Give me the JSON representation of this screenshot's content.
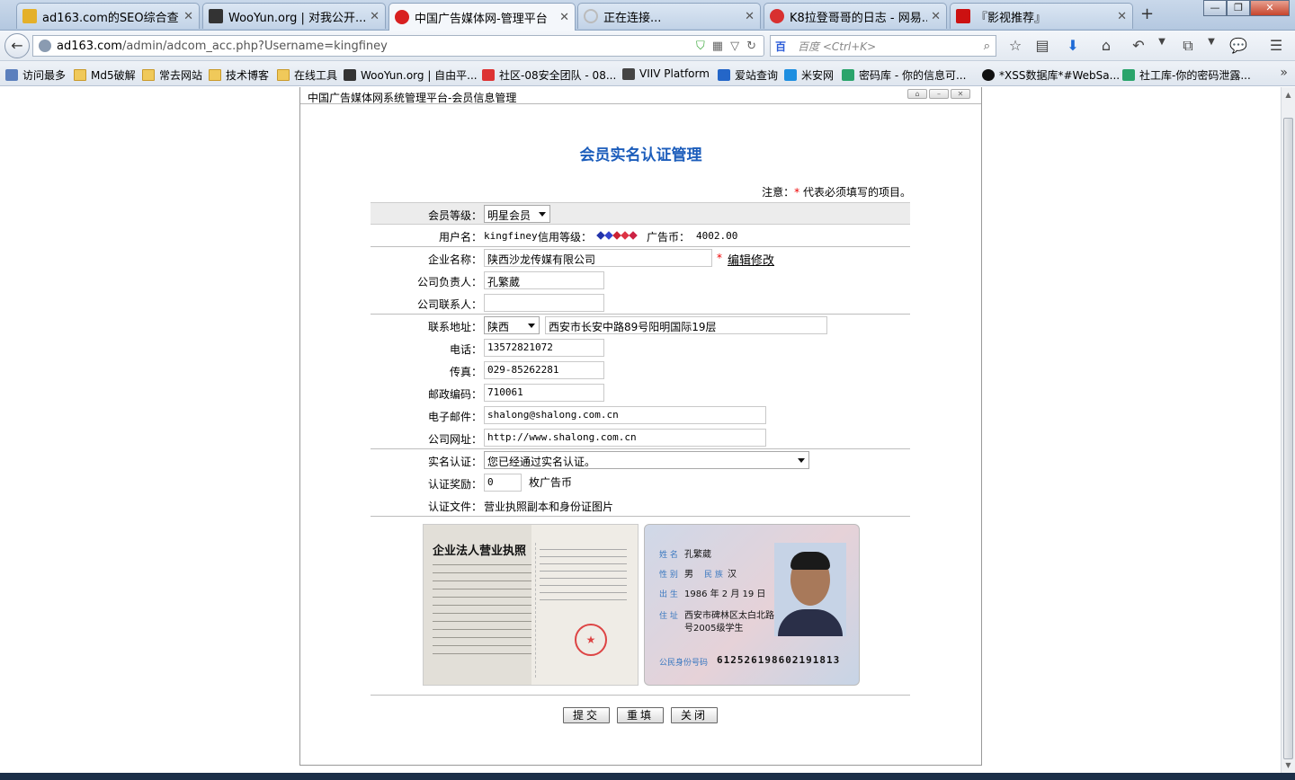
{
  "tabs": [
    {
      "title": "ad163.com的SEO综合查...",
      "fav": "#e4b02a"
    },
    {
      "title": "WooYun.org | 对我公开...",
      "fav": "#333333"
    },
    {
      "title": "中国广告媒体网-管理平台",
      "fav": "#d82020",
      "active": true
    },
    {
      "title": "正在连接...",
      "fav": "#bbbbbb"
    },
    {
      "title": "K8拉登哥哥的日志 - 网易...",
      "fav": "#d83030"
    },
    {
      "title": "『影视推荐』",
      "fav": "#cc1111"
    }
  ],
  "address": {
    "host": "ad163.com",
    "path": "/admin/adcom_acc.php?Username=kingfiney"
  },
  "search": {
    "engine": "百",
    "placeholder": "百度 <Ctrl+K>"
  },
  "bookmarks": [
    {
      "label": "访问最多",
      "icon": "site"
    },
    {
      "label": "Md5破解",
      "icon": "folder"
    },
    {
      "label": "常去网站",
      "icon": "folder"
    },
    {
      "label": "技术博客",
      "icon": "folder"
    },
    {
      "label": "在线工具",
      "icon": "folder"
    },
    {
      "label": "WooYun.org | 自由平...",
      "icon": "site"
    },
    {
      "label": "社区-08安全团队 - 08...",
      "icon": "red"
    },
    {
      "label": "VIIV Platform",
      "icon": "site"
    },
    {
      "label": "爱站查询",
      "icon": "site"
    },
    {
      "label": "米安网",
      "icon": "site"
    },
    {
      "label": "密码库 - 你的信息可...",
      "icon": "green"
    },
    {
      "label": "*XSS数据库*#WebSa...",
      "icon": "site"
    },
    {
      "label": "社工库-你的密码泄露...",
      "icon": "green"
    }
  ],
  "panel": {
    "title": "中国广告媒体网系统管理平台-会员信息管理",
    "heading": "会员实名认证管理",
    "note_prefix": "注意：",
    "note_star": "*",
    "note_suffix": " 代表必须填写的项目。"
  },
  "form": {
    "level_label": "会员等级：",
    "level_value": "明星会员",
    "username_label": "用户名：",
    "username_value": "kingfiney",
    "credit_label": "信用等级：",
    "gem_colors": [
      "#2233aa",
      "#3344cc",
      "#cc2233",
      "#dd3344",
      "#cc2244"
    ],
    "coins_label": "广告币：",
    "coins_value": "4002.00",
    "company_label": "企业名称：",
    "company_value": "陕西沙龙传媒有限公司",
    "required_star": "*",
    "edit_link": "编辑修改",
    "manager_label": "公司负责人：",
    "manager_value": "孔繁葳",
    "contact_label": "公司联系人：",
    "contact_value": "",
    "address_label": "联系地址：",
    "province_value": "陕西",
    "address_value": "西安市长安中路89号阳明国际19层",
    "phone_label": "电话：",
    "phone_value": "13572821072",
    "fax_label": "传真：",
    "fax_value": "029-85262281",
    "zip_label": "邮政编码：",
    "zip_value": "710061",
    "email_label": "电子邮件：",
    "email_value": "shalong@shalong.com.cn",
    "website_label": "公司网址：",
    "website_value": "http://www.shalong.com.cn",
    "verify_label": "实名认证：",
    "verify_value": "您已经通过实名认证。",
    "reward_label": "认证奖励：",
    "reward_value": "0",
    "reward_unit": "枚广告币",
    "doc_label": "认证文件：",
    "doc_value": "营业执照副本和身份证图片"
  },
  "license": {
    "title": "企业法人营业执照"
  },
  "idcard": {
    "name_key": "姓 名",
    "name": "孔繁葳",
    "sex_key": "性 别",
    "sex": "男",
    "nation_key": "民 族",
    "nation": "汉",
    "birth_key": "出 生",
    "birth": "1986 年 2 月 19 日",
    "addr_key": "住 址",
    "addr1": "西安市碑林区太白北路一",
    "addr2": "号2005级学生",
    "id_key": "公民身份号码",
    "id": "612526198602191813"
  },
  "buttons": {
    "submit": "提交",
    "reset": "重填",
    "close": "关闭"
  }
}
